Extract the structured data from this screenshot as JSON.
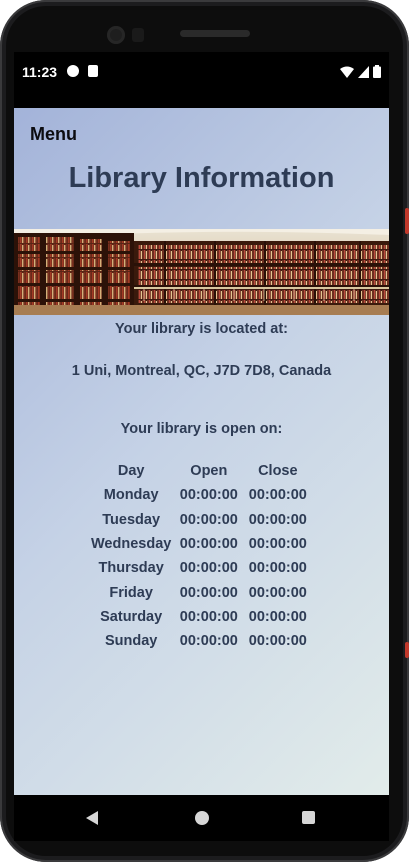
{
  "status_bar": {
    "time": "11:23"
  },
  "header": {
    "menu_label": "Menu",
    "title": "Library Information"
  },
  "location": {
    "heading": "Your library is located at:",
    "address": "1 Uni, Montreal, QC, J7D 7D8, Canada"
  },
  "hours": {
    "heading": "Your library is open on:",
    "columns": [
      "Day",
      "Open",
      "Close"
    ],
    "rows": [
      {
        "day": "Monday",
        "open": "00:00:00",
        "close": "00:00:00"
      },
      {
        "day": "Tuesday",
        "open": "00:00:00",
        "close": "00:00:00"
      },
      {
        "day": "Wednesday",
        "open": "00:00:00",
        "close": "00:00:00"
      },
      {
        "day": "Thursday",
        "open": "00:00:00",
        "close": "00:00:00"
      },
      {
        "day": "Friday",
        "open": "00:00:00",
        "close": "00:00:00"
      },
      {
        "day": "Saturday",
        "open": "00:00:00",
        "close": "00:00:00"
      },
      {
        "day": "Sunday",
        "open": "00:00:00",
        "close": "00:00:00"
      }
    ]
  },
  "icons": {
    "status": [
      "notification-icon",
      "clipboard-icon",
      "wifi-icon",
      "signal-icon",
      "battery-icon"
    ],
    "navigation": [
      "back-icon",
      "home-icon",
      "recents-icon"
    ]
  },
  "colors": {
    "title_text": "#2e3c55",
    "background_start": "#a3b3d9",
    "background_end": "#e2ecea"
  }
}
